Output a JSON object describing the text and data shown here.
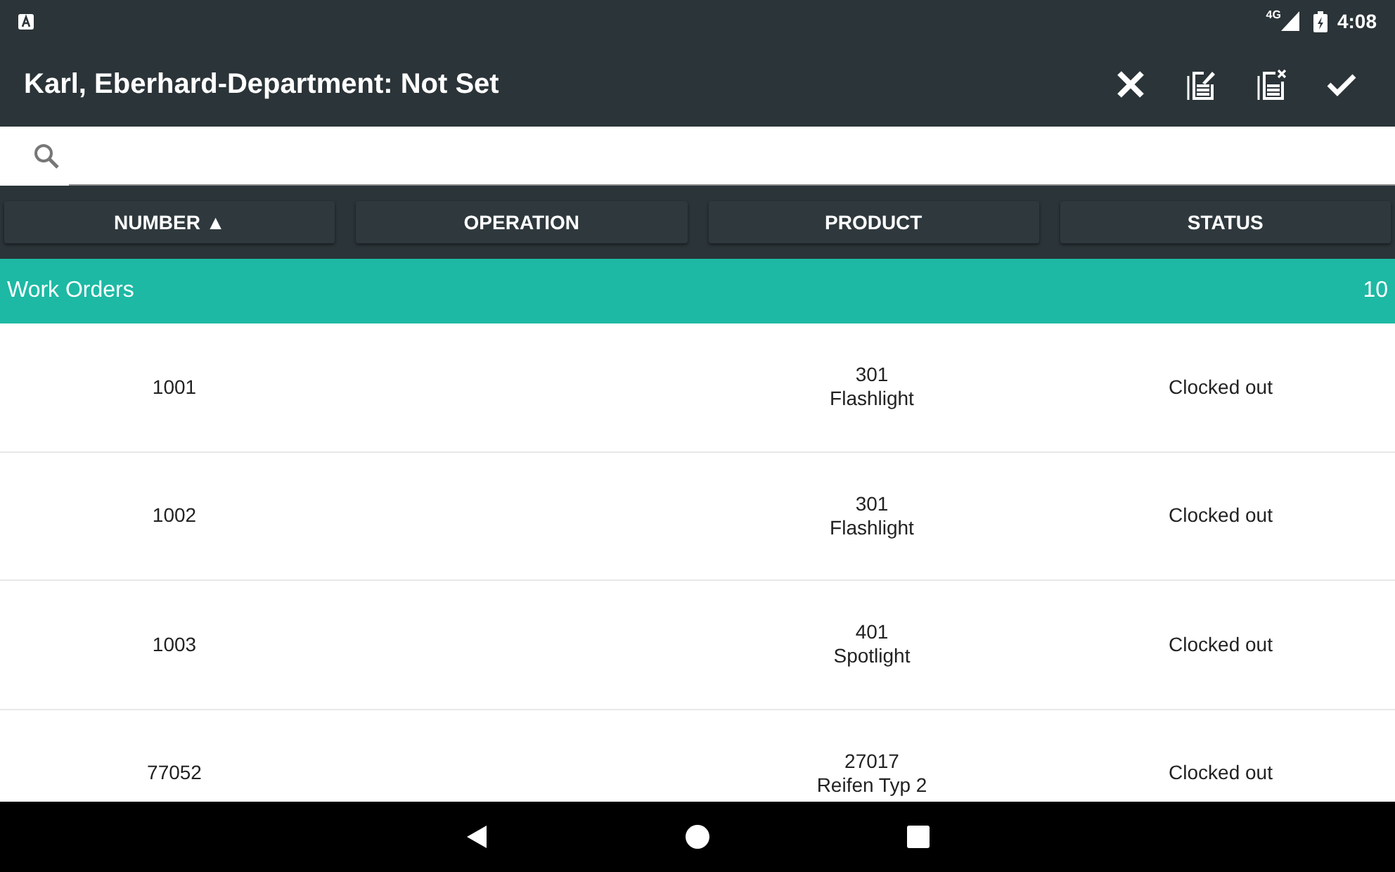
{
  "status_bar": {
    "network": "4G",
    "time": "4:08"
  },
  "toolbar": {
    "title": "Karl, Eberhard-Department: Not Set"
  },
  "columns": [
    {
      "label": "NUMBER ▲"
    },
    {
      "label": "OPERATION"
    },
    {
      "label": "PRODUCT"
    },
    {
      "label": "STATUS"
    }
  ],
  "group": {
    "label": "Work Orders",
    "count": "10"
  },
  "rows": [
    {
      "number": "1001",
      "product_code": "301",
      "product_name": "Flashlight",
      "status": "Clocked out"
    },
    {
      "number": "1002",
      "product_code": "301",
      "product_name": "Flashlight",
      "status": "Clocked out"
    },
    {
      "number": "1003",
      "product_code": "401",
      "product_name": "Spotlight",
      "status": "Clocked out"
    },
    {
      "number": "77052",
      "product_code": "27017",
      "product_name": "Reifen Typ 2",
      "status": "Clocked out"
    }
  ]
}
